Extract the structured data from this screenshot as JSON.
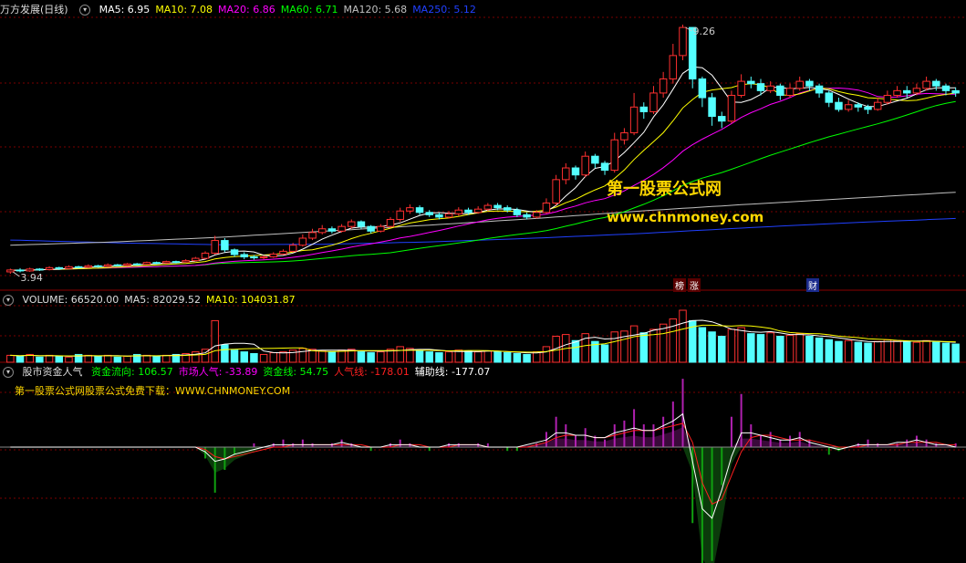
{
  "header_price": {
    "title": "万方发展(日线)",
    "ma": [
      {
        "label": "MA5: 6.95",
        "color": "#ffffff"
      },
      {
        "label": "MA10: 7.08",
        "color": "#ffff00"
      },
      {
        "label": "MA20: 6.86",
        "color": "#ff00ff"
      },
      {
        "label": "MA60: 6.71",
        "color": "#00ff00"
      },
      {
        "label": "MA120: 5.68",
        "color": "#c0c0c0"
      },
      {
        "label": "MA250: 5.12",
        "color": "#2040ff"
      }
    ]
  },
  "header_volume": {
    "items": [
      {
        "label": "VOLUME: 66520.00",
        "color": "#dddddd"
      },
      {
        "label": "MA5: 82029.52",
        "color": "#dddddd"
      },
      {
        "label": "MA10: 104031.87",
        "color": "#ffff00"
      }
    ]
  },
  "header_indicator": {
    "title": "股市资金人气",
    "items": [
      {
        "label": "资金流向: 106.57",
        "color": "#00ff00"
      },
      {
        "label": "市场人气: -33.89",
        "color": "#ff00ff"
      },
      {
        "label": "资金线: 54.75",
        "color": "#00ff00"
      },
      {
        "label": "人气线: -178.01",
        "color": "#ff2020"
      },
      {
        "label": "辅助线: -177.07",
        "color": "#ffffff"
      }
    ]
  },
  "promo_text": "第一股票公式网股票公式免费下载：WWW.CHNMONEY.COM",
  "watermark": {
    "line1": "第一股票公式网",
    "line2": "www.chnmoney.com"
  },
  "price_annotations": {
    "high": "9.26",
    "low": "3.94"
  },
  "event_tags": [
    {
      "text": "榜",
      "color": "#8b0000"
    },
    {
      "text": "涨",
      "color": "#8b0000"
    },
    {
      "text": "财",
      "color": "#1a2a8b"
    }
  ],
  "chart_data": {
    "type": "candlestick",
    "title": "万方发展(日线)",
    "up_color": "#ff3030",
    "down_color": "#54ffff",
    "price_range": [
      3.94,
      9.26
    ],
    "ma_colors": {
      "ma5": "#ffffff",
      "ma10": "#ffff00",
      "ma20": "#ff00ff",
      "ma60": "#00ff00",
      "ma120": "#c0c0c0",
      "ma250": "#2040ff"
    },
    "candles": [
      [
        3.98,
        4.02,
        4.05,
        3.94
      ],
      [
        4.02,
        4.0,
        4.06,
        3.97
      ],
      [
        4.0,
        4.04,
        4.07,
        3.98
      ],
      [
        4.04,
        4.03,
        4.06,
        4.0
      ],
      [
        4.03,
        4.07,
        4.1,
        4.01
      ],
      [
        4.07,
        4.05,
        4.09,
        4.02
      ],
      [
        4.05,
        4.09,
        4.12,
        4.04
      ],
      [
        4.09,
        4.08,
        4.11,
        4.05
      ],
      [
        4.08,
        4.11,
        4.14,
        4.06
      ],
      [
        4.11,
        4.1,
        4.13,
        4.07
      ],
      [
        4.1,
        4.13,
        4.16,
        4.08
      ],
      [
        4.13,
        4.12,
        4.15,
        4.1
      ],
      [
        4.12,
        4.15,
        4.17,
        4.1
      ],
      [
        4.15,
        4.14,
        4.17,
        4.12
      ],
      [
        4.14,
        4.18,
        4.2,
        4.13
      ],
      [
        4.18,
        4.17,
        4.2,
        4.14
      ],
      [
        4.17,
        4.2,
        4.22,
        4.15
      ],
      [
        4.2,
        4.19,
        4.22,
        4.16
      ],
      [
        4.19,
        4.22,
        4.25,
        4.18
      ],
      [
        4.22,
        4.27,
        4.3,
        4.2
      ],
      [
        4.27,
        4.38,
        4.42,
        4.25
      ],
      [
        4.38,
        4.65,
        4.75,
        4.35
      ],
      [
        4.65,
        4.45,
        4.7,
        4.4
      ],
      [
        4.45,
        4.35,
        4.48,
        4.3
      ],
      [
        4.35,
        4.3,
        4.4,
        4.25
      ],
      [
        4.3,
        4.28,
        4.34,
        4.24
      ],
      [
        4.28,
        4.3,
        4.33,
        4.25
      ],
      [
        4.3,
        4.36,
        4.4,
        4.28
      ],
      [
        4.36,
        4.42,
        4.46,
        4.34
      ],
      [
        4.42,
        4.55,
        4.6,
        4.4
      ],
      [
        4.55,
        4.7,
        4.78,
        4.52
      ],
      [
        4.7,
        4.82,
        4.9,
        4.66
      ],
      [
        4.82,
        4.9,
        4.98,
        4.78
      ],
      [
        4.9,
        4.85,
        4.95,
        4.8
      ],
      [
        4.85,
        4.95,
        5.0,
        4.82
      ],
      [
        4.95,
        5.05,
        5.1,
        4.9
      ],
      [
        5.05,
        4.95,
        5.08,
        4.9
      ],
      [
        4.95,
        4.85,
        4.98,
        4.8
      ],
      [
        4.85,
        4.95,
        5.0,
        4.82
      ],
      [
        4.95,
        5.1,
        5.15,
        4.92
      ],
      [
        5.1,
        5.28,
        5.35,
        5.05
      ],
      [
        5.28,
        5.35,
        5.42,
        5.22
      ],
      [
        5.35,
        5.25,
        5.4,
        5.2
      ],
      [
        5.25,
        5.2,
        5.3,
        5.15
      ],
      [
        5.2,
        5.15,
        5.25,
        5.1
      ],
      [
        5.15,
        5.22,
        5.28,
        5.12
      ],
      [
        5.22,
        5.3,
        5.36,
        5.18
      ],
      [
        5.3,
        5.25,
        5.35,
        5.2
      ],
      [
        5.25,
        5.32,
        5.38,
        5.22
      ],
      [
        5.32,
        5.4,
        5.45,
        5.28
      ],
      [
        5.4,
        5.35,
        5.45,
        5.3
      ],
      [
        5.35,
        5.3,
        5.4,
        5.25
      ],
      [
        5.3,
        5.2,
        5.35,
        5.15
      ],
      [
        5.2,
        5.15,
        5.25,
        5.1
      ],
      [
        5.15,
        5.25,
        5.3,
        5.12
      ],
      [
        5.25,
        5.45,
        5.55,
        5.22
      ],
      [
        5.45,
        5.95,
        6.05,
        5.4
      ],
      [
        5.95,
        6.2,
        6.3,
        5.85
      ],
      [
        6.2,
        6.05,
        6.25,
        5.95
      ],
      [
        6.05,
        6.45,
        6.55,
        6.0
      ],
      [
        6.45,
        6.3,
        6.5,
        6.2
      ],
      [
        6.3,
        6.15,
        6.35,
        6.05
      ],
      [
        6.15,
        6.8,
        6.95,
        6.1
      ],
      [
        6.8,
        6.95,
        7.05,
        6.7
      ],
      [
        6.95,
        7.5,
        7.8,
        6.9
      ],
      [
        7.5,
        7.4,
        7.6,
        7.25
      ],
      [
        7.4,
        7.8,
        7.95,
        7.35
      ],
      [
        7.8,
        8.1,
        8.25,
        7.7
      ],
      [
        8.1,
        8.6,
        8.85,
        8.0
      ],
      [
        8.6,
        9.2,
        9.26,
        8.5
      ],
      [
        9.2,
        8.1,
        9.1,
        7.9
      ],
      [
        8.1,
        7.7,
        8.15,
        7.5
      ],
      [
        7.7,
        7.3,
        7.8,
        7.1
      ],
      [
        7.3,
        7.2,
        7.4,
        7.05
      ],
      [
        7.2,
        7.75,
        7.85,
        7.15
      ],
      [
        7.75,
        8.05,
        8.2,
        7.7
      ],
      [
        8.05,
        8.0,
        8.15,
        7.9
      ],
      [
        8.0,
        7.85,
        8.1,
        7.75
      ],
      [
        7.85,
        7.95,
        8.05,
        7.8
      ],
      [
        7.95,
        7.75,
        8.0,
        7.65
      ],
      [
        7.75,
        7.9,
        8.0,
        7.7
      ],
      [
        7.9,
        8.05,
        8.15,
        7.85
      ],
      [
        8.05,
        7.95,
        8.1,
        7.85
      ],
      [
        7.95,
        7.8,
        8.0,
        7.7
      ],
      [
        7.8,
        7.6,
        7.85,
        7.5
      ],
      [
        7.6,
        7.45,
        7.7,
        7.4
      ],
      [
        7.45,
        7.55,
        7.65,
        7.4
      ],
      [
        7.55,
        7.5,
        7.6,
        7.4
      ],
      [
        7.5,
        7.45,
        7.55,
        7.35
      ],
      [
        7.45,
        7.6,
        7.7,
        7.42
      ],
      [
        7.6,
        7.75,
        7.85,
        7.55
      ],
      [
        7.75,
        7.85,
        7.95,
        7.7
      ],
      [
        7.85,
        7.8,
        7.95,
        7.7
      ],
      [
        7.8,
        7.9,
        8.0,
        7.75
      ],
      [
        7.9,
        8.05,
        8.15,
        7.85
      ],
      [
        8.05,
        7.95,
        8.1,
        7.85
      ],
      [
        7.95,
        7.85,
        8.0,
        7.75
      ],
      [
        7.85,
        7.8,
        7.92,
        7.72
      ]
    ],
    "ma120": [
      4.55,
      4.62,
      4.72,
      4.85,
      4.98,
      5.12,
      5.28,
      5.42,
      5.55,
      5.68
    ],
    "ma250": [
      4.66,
      4.6,
      4.56,
      4.57,
      4.62,
      4.7,
      4.8,
      4.92,
      5.03,
      5.12
    ],
    "volume": [
      8,
      7,
      9,
      6,
      8,
      7,
      6,
      9,
      8,
      7,
      8,
      6,
      7,
      9,
      8,
      7,
      8,
      9,
      10,
      12,
      15,
      48,
      20,
      14,
      12,
      10,
      9,
      11,
      12,
      14,
      16,
      15,
      13,
      12,
      14,
      15,
      12,
      11,
      12,
      15,
      18,
      16,
      13,
      12,
      11,
      12,
      14,
      13,
      12,
      13,
      12,
      11,
      10,
      9,
      12,
      18,
      30,
      32,
      25,
      33,
      24,
      20,
      35,
      36,
      42,
      34,
      38,
      44,
      50,
      60,
      48,
      40,
      35,
      30,
      38,
      40,
      33,
      32,
      34,
      30,
      31,
      33,
      30,
      28,
      26,
      24,
      25,
      23,
      22,
      24,
      26,
      25,
      24,
      23,
      25,
      24,
      22,
      21
    ],
    "volume_ma5_label": "MA5",
    "indicator": {
      "bars": [
        0,
        0,
        0,
        0,
        0,
        0,
        0,
        0,
        0,
        0,
        0,
        0,
        0,
        0,
        0,
        0,
        0,
        0,
        0,
        0,
        -3,
        -12,
        -6,
        -2,
        0,
        1,
        0,
        1,
        2,
        1,
        2,
        1,
        0,
        1,
        2,
        1,
        0,
        -1,
        0,
        1,
        2,
        1,
        0,
        -1,
        0,
        1,
        1,
        0,
        1,
        1,
        0,
        -1,
        -1,
        0,
        1,
        4,
        8,
        6,
        3,
        5,
        3,
        2,
        6,
        7,
        10,
        6,
        6,
        8,
        12,
        18,
        -20,
        -40,
        -30,
        -10,
        8,
        14,
        6,
        3,
        4,
        2,
        3,
        4,
        2,
        0,
        -2,
        -1,
        0,
        1,
        2,
        1,
        0,
        1,
        2,
        3,
        2,
        1,
        0,
        1
      ],
      "redline": [
        0,
        0,
        0,
        0,
        0,
        0,
        0,
        0,
        0,
        0,
        0,
        0,
        0,
        0,
        0,
        0,
        0,
        0,
        0,
        0,
        -1,
        -4,
        -5,
        -4,
        -3,
        -2,
        -1,
        0,
        0,
        1,
        1,
        1,
        1,
        1,
        1,
        1,
        1,
        0,
        0,
        0,
        1,
        1,
        1,
        0,
        0,
        0,
        1,
        1,
        1,
        0,
        0,
        0,
        0,
        0,
        1,
        2,
        4,
        5,
        5,
        5,
        4,
        4,
        5,
        6,
        7,
        7,
        7,
        8,
        9,
        10,
        2,
        -15,
        -24,
        -22,
        -12,
        -2,
        4,
        5,
        5,
        4,
        3,
        3,
        3,
        2,
        1,
        0,
        0,
        0,
        1,
        1,
        1,
        1,
        2,
        2,
        2,
        2,
        1,
        1
      ],
      "whiteline": [
        0,
        0,
        0,
        0,
        0,
        0,
        0,
        0,
        0,
        0,
        0,
        0,
        0,
        0,
        0,
        0,
        0,
        0,
        0,
        0,
        -2,
        -6,
        -5,
        -3,
        -2,
        -1,
        0,
        1,
        1,
        1,
        1,
        1,
        1,
        1,
        2,
        1,
        0,
        0,
        0,
        1,
        1,
        1,
        0,
        0,
        0,
        1,
        1,
        1,
        1,
        0,
        0,
        0,
        0,
        1,
        2,
        3,
        6,
        6,
        5,
        5,
        4,
        4,
        6,
        7,
        8,
        7,
        7,
        9,
        11,
        14,
        -6,
        -26,
        -30,
        -18,
        -4,
        6,
        6,
        5,
        4,
        3,
        3,
        4,
        2,
        1,
        0,
        -1,
        0,
        1,
        1,
        1,
        1,
        2,
        2,
        3,
        2,
        1,
        1,
        0
      ]
    }
  }
}
